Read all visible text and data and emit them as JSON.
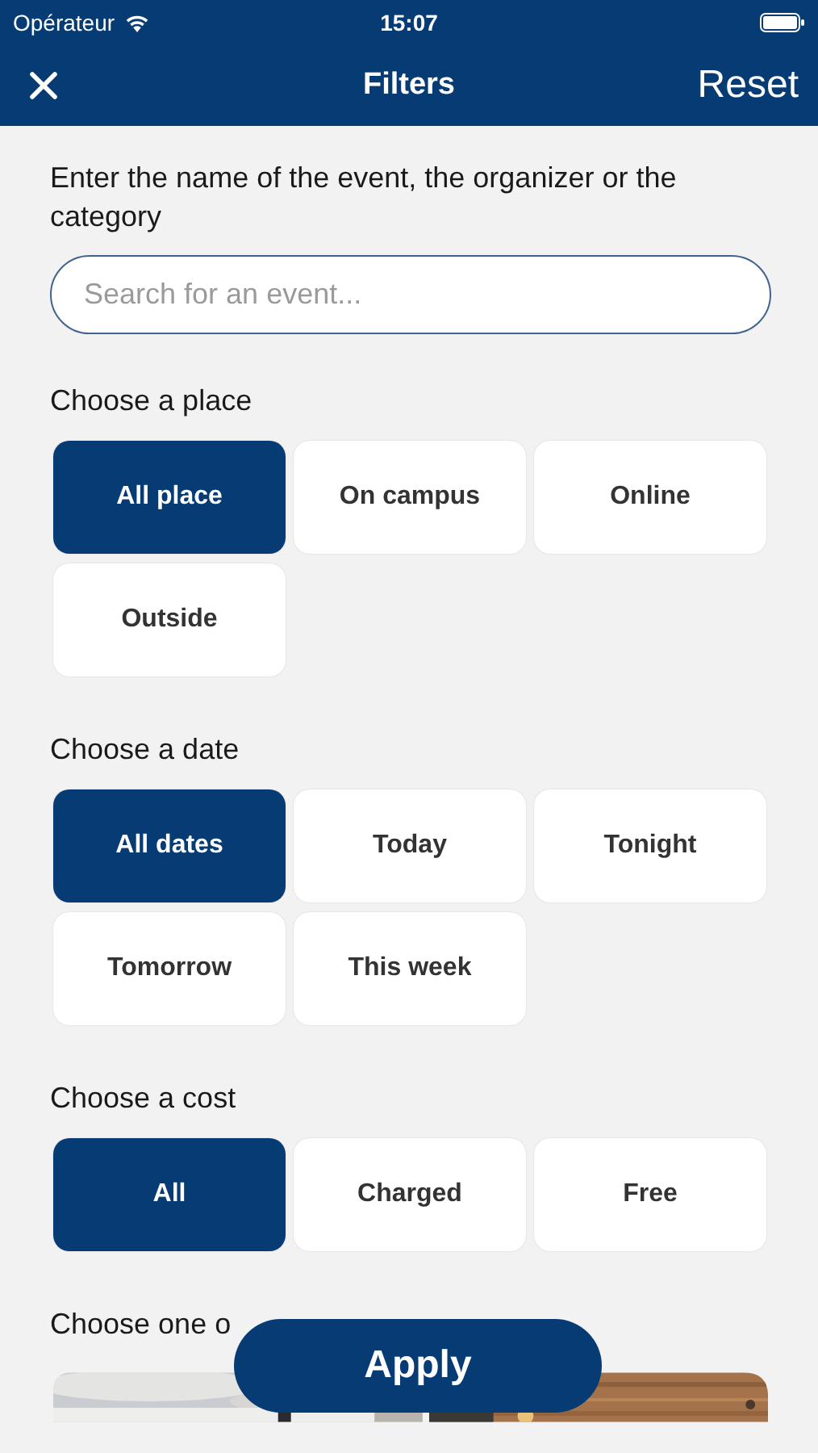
{
  "status_bar": {
    "carrier": "Opérateur",
    "time": "15:07"
  },
  "nav": {
    "title": "Filters",
    "reset": "Reset"
  },
  "search": {
    "prompt": "Enter the name of the event, the organizer or the category",
    "placeholder": "Search for an event..."
  },
  "sections": [
    {
      "heading": "Choose a place",
      "options": [
        {
          "label": "All place",
          "selected": true
        },
        {
          "label": "On campus",
          "selected": false
        },
        {
          "label": "Online",
          "selected": false
        },
        {
          "label": "Outside",
          "selected": false
        }
      ]
    },
    {
      "heading": "Choose a date",
      "options": [
        {
          "label": "All dates",
          "selected": true
        },
        {
          "label": "Today",
          "selected": false
        },
        {
          "label": "Tonight",
          "selected": false
        },
        {
          "label": "Tomorrow",
          "selected": false
        },
        {
          "label": "This week",
          "selected": false
        }
      ]
    },
    {
      "heading": "Choose a cost",
      "options": [
        {
          "label": "All",
          "selected": true
        },
        {
          "label": "Charged",
          "selected": false
        },
        {
          "label": "Free",
          "selected": false
        }
      ]
    }
  ],
  "categories": {
    "heading": "Choose one o"
  },
  "apply_button": "Apply"
}
